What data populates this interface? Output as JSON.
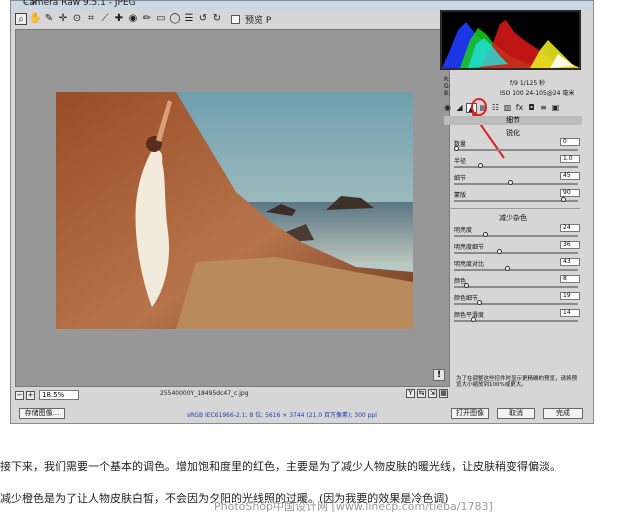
{
  "window": {
    "title": "Camera Raw 9.5.1 - JPEG",
    "controls": "–  ×"
  },
  "toolbar": {
    "tools": [
      {
        "name": "zoom-tool-icon",
        "glyph": "⌕"
      },
      {
        "name": "hand-tool-icon",
        "glyph": "✋"
      },
      {
        "name": "white-balance-tool-icon",
        "glyph": "✎"
      },
      {
        "name": "color-sampler-tool-icon",
        "glyph": "✛"
      },
      {
        "name": "targeted-adjustment-tool-icon",
        "glyph": "⊙"
      },
      {
        "name": "crop-tool-icon",
        "glyph": "⌗"
      },
      {
        "name": "straighten-tool-icon",
        "glyph": "⟋"
      },
      {
        "name": "spot-removal-tool-icon",
        "glyph": "✚"
      },
      {
        "name": "red-eye-tool-icon",
        "glyph": "◉"
      },
      {
        "name": "adjustment-brush-icon",
        "glyph": "✏"
      },
      {
        "name": "graduated-filter-icon",
        "glyph": "▭"
      },
      {
        "name": "radial-filter-icon",
        "glyph": "◯"
      },
      {
        "name": "preferences-icon",
        "glyph": "☰"
      },
      {
        "name": "rotate-left-icon",
        "glyph": "↺"
      },
      {
        "name": "rotate-right-icon",
        "glyph": "↻"
      }
    ],
    "preview_label": "预览 P"
  },
  "status": {
    "zoom": "18.5%",
    "filename": "25540000Y_18495dc47_c.jpg"
  },
  "bottom": {
    "save_label": "存储图像...",
    "workflow_text": "sRGB IEC61966-2.1; 8 位; 5616 × 3744 (21.0 百万像素); 300 ppi",
    "open_label": "打开图像",
    "cancel_label": "取消",
    "done_label": "完成"
  },
  "info": {
    "rgb": [
      "R:",
      "G:",
      "B:"
    ],
    "exif1": "f/9    1/125 秒",
    "exif2": "ISO 100    24-105@24 毫米"
  },
  "tabs": [
    "◉",
    "◢",
    "▲",
    "▤",
    "☷",
    "▥",
    "fx",
    "◘",
    "≡",
    "▣"
  ],
  "panel": {
    "title": "细节",
    "sharpen_heading": "锐化",
    "sharpen": [
      {
        "label": "数量",
        "value": "0",
        "pos": 0.0
      },
      {
        "label": "半径",
        "value": "1.0",
        "pos": 0.2
      },
      {
        "label": "细节",
        "value": "45",
        "pos": 0.45
      },
      {
        "label": "蒙版",
        "value": "90",
        "pos": 0.9
      }
    ],
    "nr_heading": "减少杂色",
    "noise_reduction": [
      {
        "label": "明亮度",
        "value": "24",
        "pos": 0.24
      },
      {
        "label": "明亮度细节",
        "value": "36",
        "pos": 0.36
      },
      {
        "label": "明亮度对比",
        "value": "43",
        "pos": 0.43
      },
      {
        "label": "颜色",
        "value": "8",
        "pos": 0.08
      },
      {
        "label": "颜色细节",
        "value": "19",
        "pos": 0.19
      },
      {
        "label": "颜色平滑度",
        "value": "14",
        "pos": 0.14
      }
    ],
    "note": "为了在调整这些控件时显示更精确的预览，请将预览大小缩放到100%或更大。"
  },
  "article": {
    "p1": "接下来，我们需要一个基本的调色。增加饱和度里的红色，主要是为了减少人物皮肤的暖光线，让皮肤稍变得偏淡。",
    "p2": "减少橙色是为了让人物皮肤白皙，不会因为夕阳的光线照的过暖。(因为我要的效果是冷色调)",
    "watermark": "PhotoShop中国设计网 [www.linecp.com/tieba/1783]"
  },
  "colors": {
    "accent_red": "#e02222",
    "panel_bg": "#d6d6d6",
    "canvas_bg": "#979797"
  }
}
